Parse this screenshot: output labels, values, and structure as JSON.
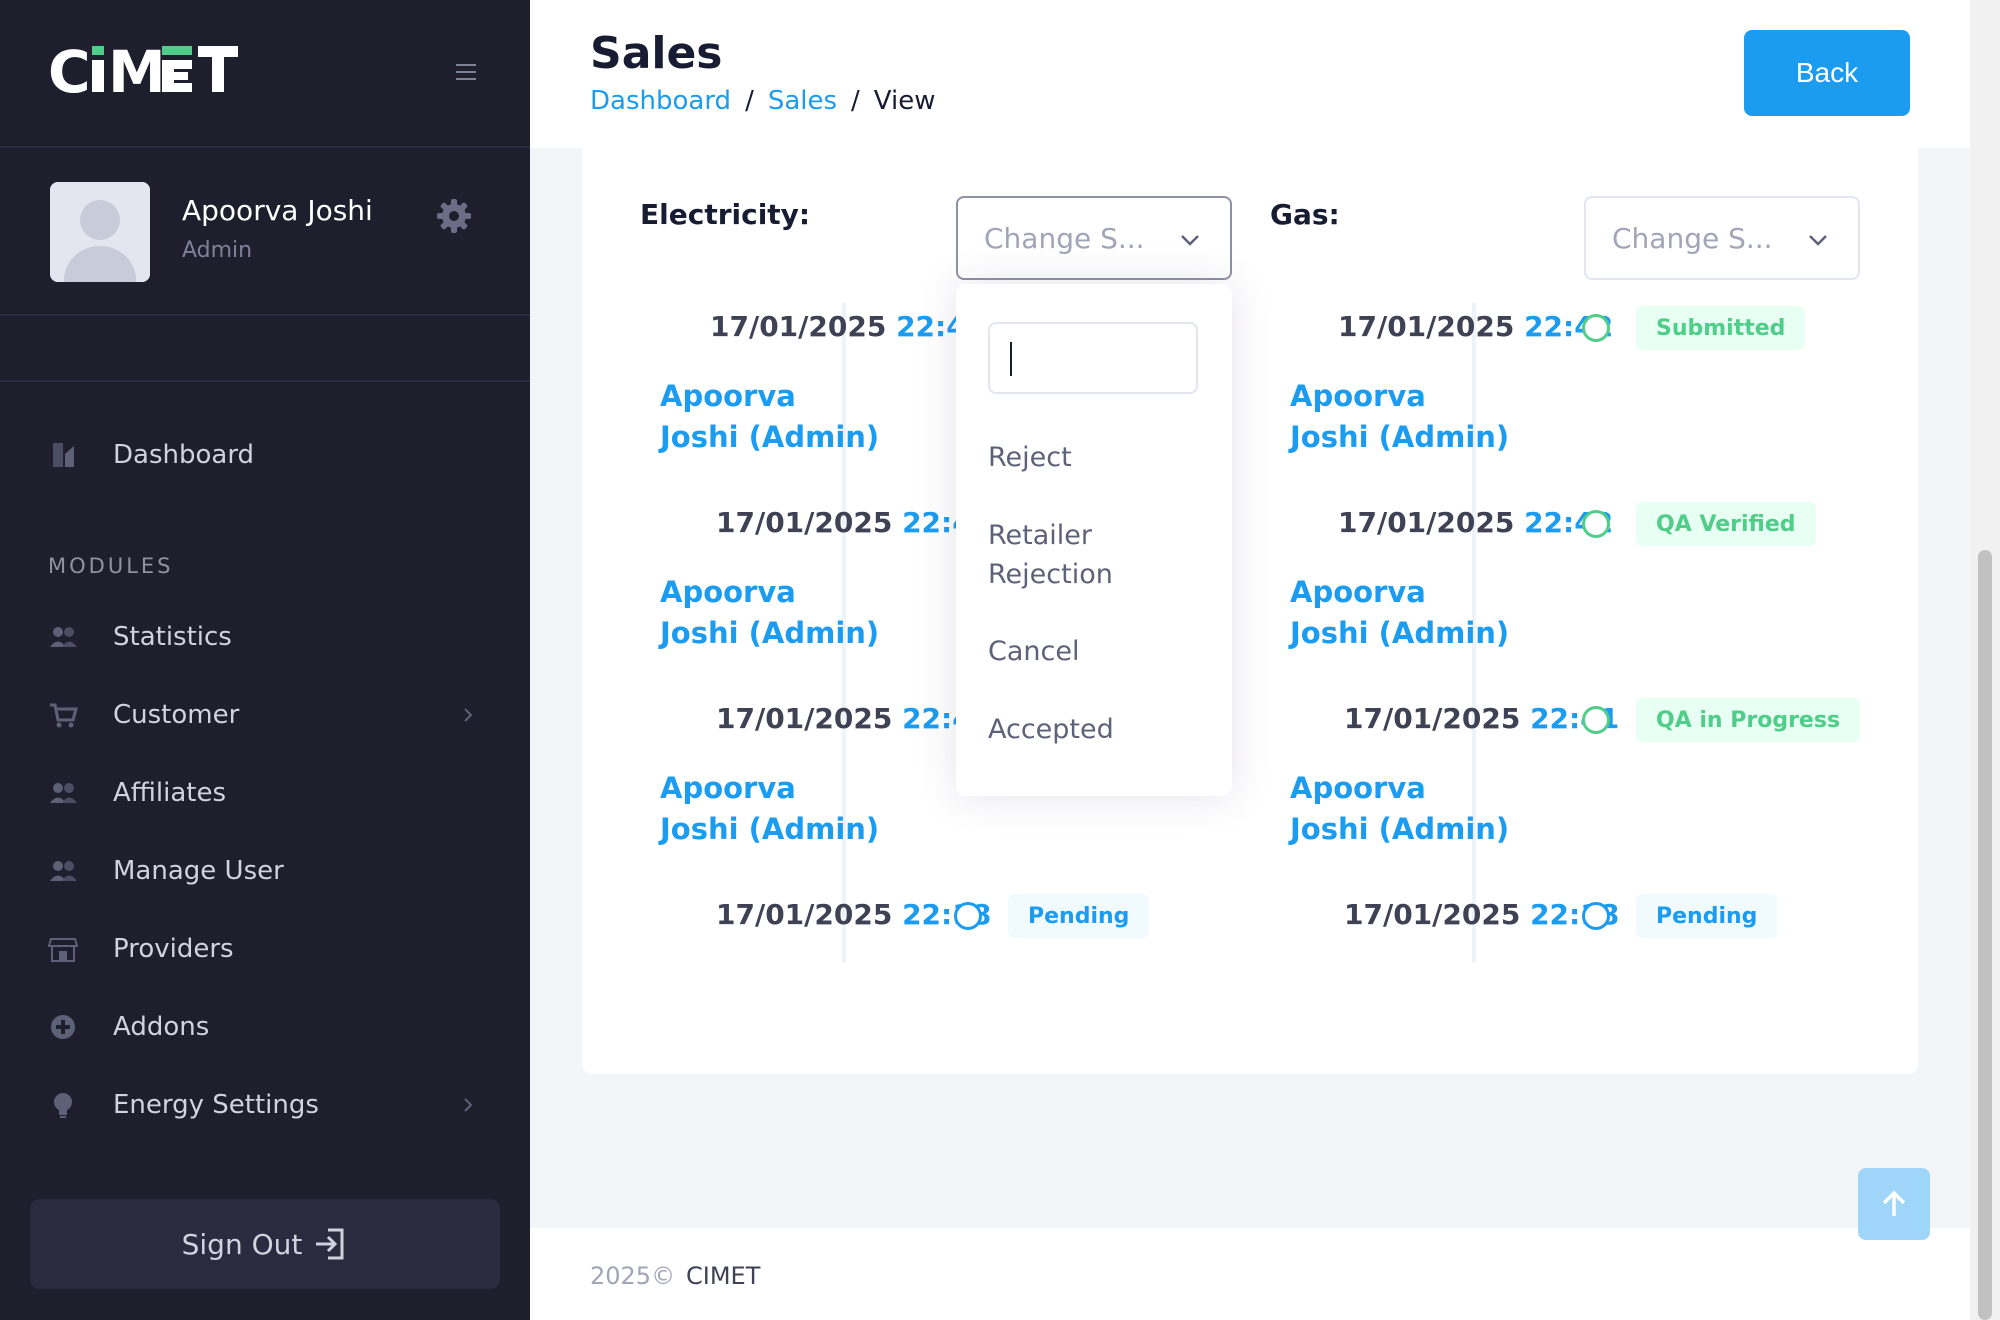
{
  "sidebar": {
    "logo": "CIMET",
    "user": {
      "name": "Apoorva Joshi",
      "role": "Admin"
    },
    "modules_label": "MODULES",
    "items": [
      {
        "label": "Dashboard",
        "icon": "dashboard-icon"
      },
      {
        "label": "Statistics",
        "icon": "users-icon"
      },
      {
        "label": "Customer",
        "icon": "cart-icon",
        "has_submenu": true
      },
      {
        "label": "Affiliates",
        "icon": "users-icon"
      },
      {
        "label": "Manage User",
        "icon": "users-icon"
      },
      {
        "label": "Providers",
        "icon": "store-icon"
      },
      {
        "label": "Addons",
        "icon": "plus-circle-icon"
      },
      {
        "label": "Energy Settings",
        "icon": "bulb-icon",
        "has_submenu": true
      }
    ],
    "signout_label": "Sign Out"
  },
  "header": {
    "title": "Sales",
    "breadcrumb": {
      "dashboard": "Dashboard",
      "sales": "Sales",
      "current": "View",
      "separator": "/"
    },
    "back_label": "Back"
  },
  "electricity": {
    "label": "Electricity:",
    "select_placeholder": "Change S...",
    "timeline": [
      {
        "date": "17/01/2025",
        "time": "22:42",
        "user": "Apoorva Joshi (Admin)"
      },
      {
        "date": "17/01/2025",
        "time": "22:41",
        "user": "Apoorva Joshi (Admin)"
      },
      {
        "date": "17/01/2025",
        "time": "22:41",
        "user": "Apoorva Joshi (Admin)"
      },
      {
        "date": "17/01/2025",
        "time": "22:18",
        "status": "Pending"
      }
    ]
  },
  "gas": {
    "label": "Gas:",
    "select_placeholder": "Change S...",
    "timeline": [
      {
        "date": "17/01/2025",
        "time": "22:42",
        "status": "Submitted",
        "user": "Apoorva Joshi (Admin)"
      },
      {
        "date": "17/01/2025",
        "time": "22:42",
        "status": "QA Verified",
        "user": "Apoorva Joshi (Admin)"
      },
      {
        "date": "17/01/2025",
        "time": "22:41",
        "status": "QA in Progress",
        "user": "Apoorva Joshi (Admin)"
      },
      {
        "date": "17/01/2025",
        "time": "22:18",
        "status": "Pending"
      }
    ]
  },
  "dropdown": {
    "search_value": "",
    "options": [
      "Reject",
      "Retailer Rejection",
      "Cancel",
      "Accepted"
    ]
  },
  "footer": {
    "year": "2025©",
    "brand": "CIMET"
  },
  "colors": {
    "sidebar_bg": "#1e1e2d",
    "accent": "#1b9cf0",
    "success": "#50cd89"
  }
}
